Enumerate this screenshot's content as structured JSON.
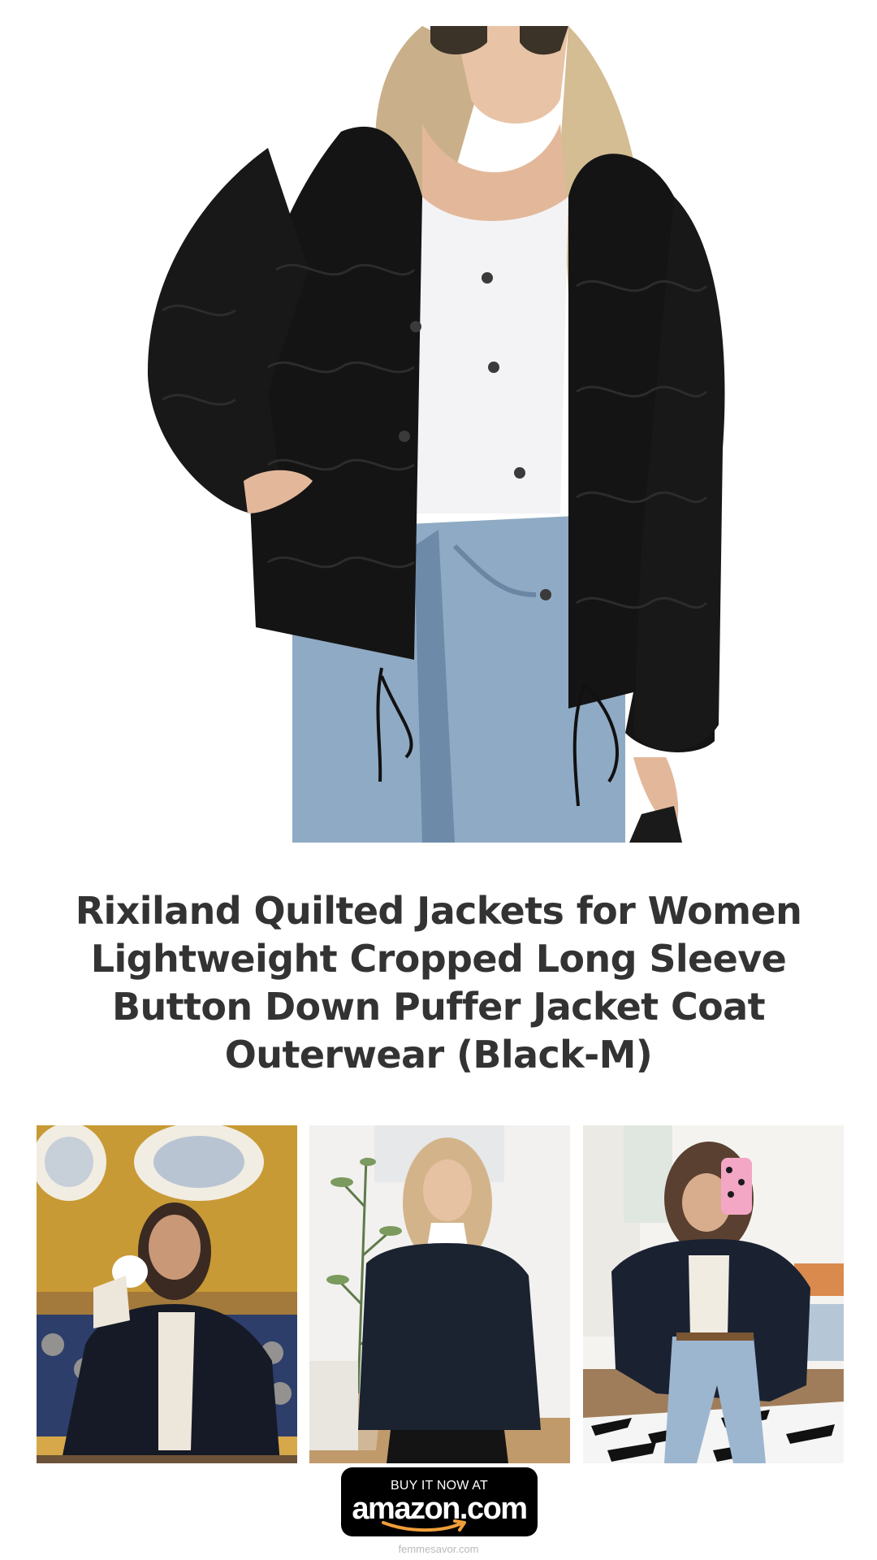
{
  "product": {
    "title": "Rixiland Quilted Jackets for Women Lightweight Cropped Long Sleeve Button Down Puffer Jacket Coat Outerwear (Black-M)",
    "hero_image": "woman wearing black quilted cropped jacket with white top and blue jeans",
    "color": "#111111"
  },
  "gallery": [
    {
      "image": "woman holding mug wearing black quilted jacket in front of wall plates"
    },
    {
      "image": "blonde woman wearing black quilted jacket and turtleneck"
    },
    {
      "image": "woman taking mirror selfie in black quilted jacket and jeans"
    }
  ],
  "cta": {
    "line": "BUY IT NOW AT",
    "brand": "amazon.com",
    "accent": "#f19e39"
  },
  "footer": {
    "site": "femmesavor.com"
  }
}
